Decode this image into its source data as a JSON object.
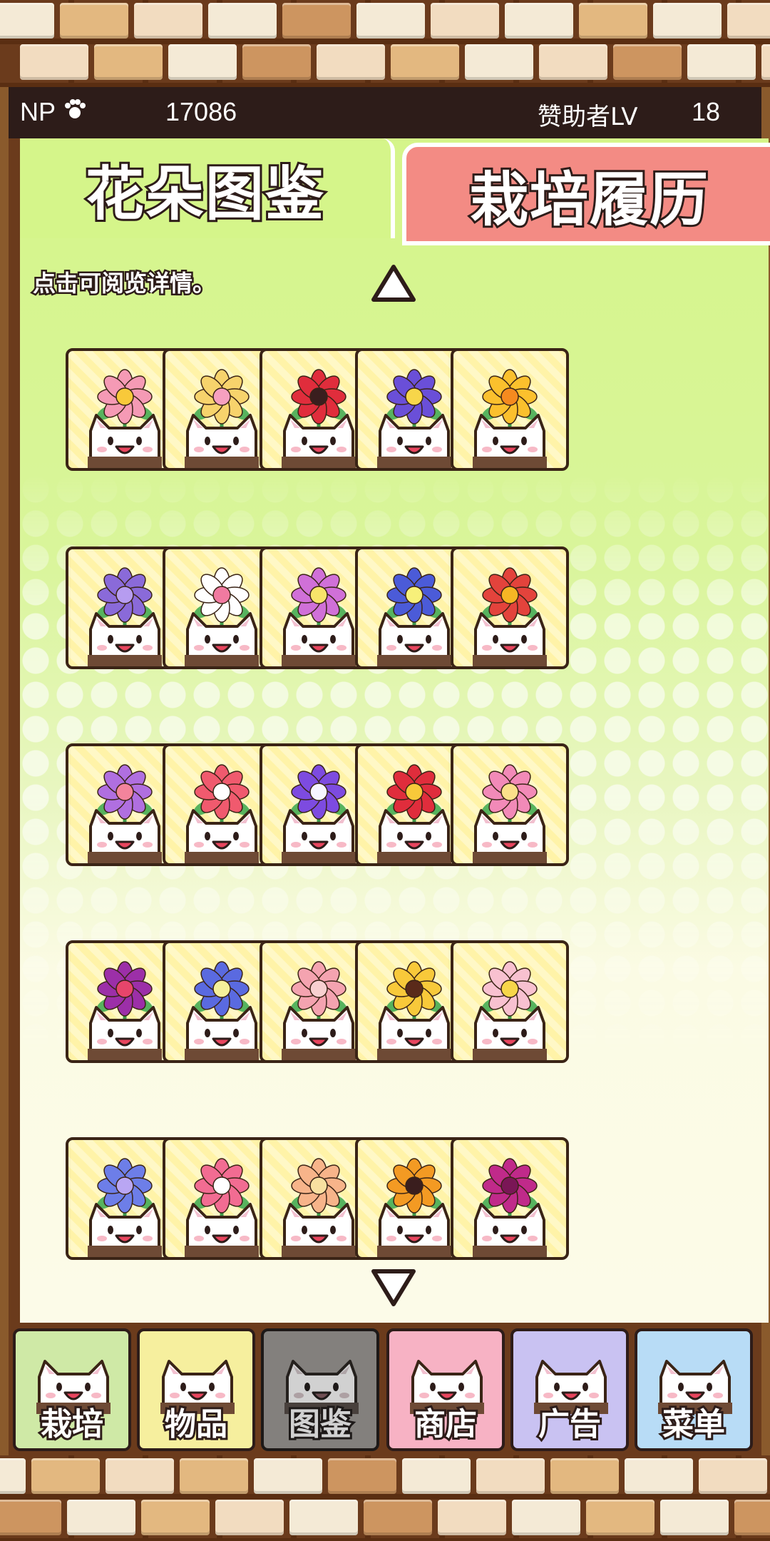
{
  "header": {
    "np_label": "NP",
    "np_value": "17086",
    "sponsor_label": "赞助者LV",
    "sponsor_level": "18"
  },
  "tabs": [
    {
      "label": "花朵图鉴",
      "active": true
    },
    {
      "label": "栽培履历",
      "active": false
    }
  ],
  "hint": "点击可阅览详情。",
  "flowers": [
    {
      "icon": "pink-cosmos-icon",
      "petal": "#f59ab5",
      "center": "#f8c93a"
    },
    {
      "icon": "rose-cabbage-icon",
      "petal": "#f7d36c",
      "center": "#f6a0c0"
    },
    {
      "icon": "red-poppy-icon",
      "petal": "#e02d3c",
      "center": "#3a1e1e"
    },
    {
      "icon": "blue-iris-icon",
      "petal": "#6a4fd8",
      "center": "#f7d64a"
    },
    {
      "icon": "yellow-daisy-icon",
      "petal": "#fbc02d",
      "center": "#f58a1f"
    },
    {
      "icon": "lavender-icon",
      "petal": "#8a6ad9",
      "center": "#b69cf0"
    },
    {
      "icon": "white-plum-icon",
      "petal": "#ffffff",
      "center": "#f07aa0"
    },
    {
      "icon": "purple-dahlia-icon",
      "petal": "#d070d8",
      "center": "#f7e46a"
    },
    {
      "icon": "balloon-flower-icon",
      "petal": "#4b5bd8",
      "center": "#f7f07a"
    },
    {
      "icon": "red-lantana-icon",
      "petal": "#e3433c",
      "center": "#f6b624"
    },
    {
      "icon": "sweet-pea-icon",
      "petal": "#b06fe0",
      "center": "#f3849c"
    },
    {
      "icon": "red-carnation-icon",
      "petal": "#f05a6e",
      "center": "#ffffff"
    },
    {
      "icon": "morning-glory-icon",
      "petal": "#7d4be0",
      "center": "#f7f5ff"
    },
    {
      "icon": "red-camellia-icon",
      "petal": "#e02d3c",
      "center": "#f8c93a"
    },
    {
      "icon": "lotus-icon",
      "petal": "#f28ab8",
      "center": "#fbe08a"
    },
    {
      "icon": "purple-parasol-icon",
      "petal": "#9c2fa8",
      "center": "#e7456b"
    },
    {
      "icon": "blue-clematis-icon",
      "petal": "#5a6ae0",
      "center": "#f5f09a"
    },
    {
      "icon": "pink-peony-icon",
      "petal": "#f4a3b0",
      "center": "#f7d0d0"
    },
    {
      "icon": "pansy-icon",
      "petal": "#f8c93a",
      "center": "#5a2a1a"
    },
    {
      "icon": "pink-hibiscus-icon",
      "petal": "#f8c1d0",
      "center": "#f7d64a"
    },
    {
      "icon": "hydrangea-icon",
      "petal": "#6d7ee8",
      "center": "#b9a6f3"
    },
    {
      "icon": "cyclamen-icon",
      "petal": "#f26c92",
      "center": "#ffffff"
    },
    {
      "icon": "fringe-flower-icon",
      "petal": "#f7b48a",
      "center": "#f8e0a0"
    },
    {
      "icon": "jack-o-lantern-icon",
      "petal": "#f39a23",
      "center": "#3a1e1e"
    },
    {
      "icon": "spider-lily-icon",
      "petal": "#c02a8a",
      "center": "#7a1656"
    }
  ],
  "nav": [
    {
      "label": "栽培",
      "icon": "flower-pot-icon",
      "bg": "#cfe9a6",
      "active": false
    },
    {
      "label": "物品",
      "icon": "item-bag-icon",
      "bg": "#f6ef9e",
      "active": false
    },
    {
      "label": "图鉴",
      "icon": "encyclopedia-book-icon",
      "bg": "#a89b8a",
      "active": true
    },
    {
      "label": "商店",
      "icon": "shop-icon",
      "bg": "#f7b2c4",
      "active": false
    },
    {
      "label": "广告",
      "icon": "sunglasses-cat-icon",
      "bg": "#c9c2f2",
      "active": false
    },
    {
      "label": "菜单",
      "icon": "menu-sprout-icon",
      "bg": "#b8dcf6",
      "active": false
    }
  ],
  "colors": {
    "outline": "#2d1c19",
    "frame": "#6b3b1c",
    "tab_active_bg": "#d5f58a",
    "tab_inactive_bg": "#f38b84"
  }
}
